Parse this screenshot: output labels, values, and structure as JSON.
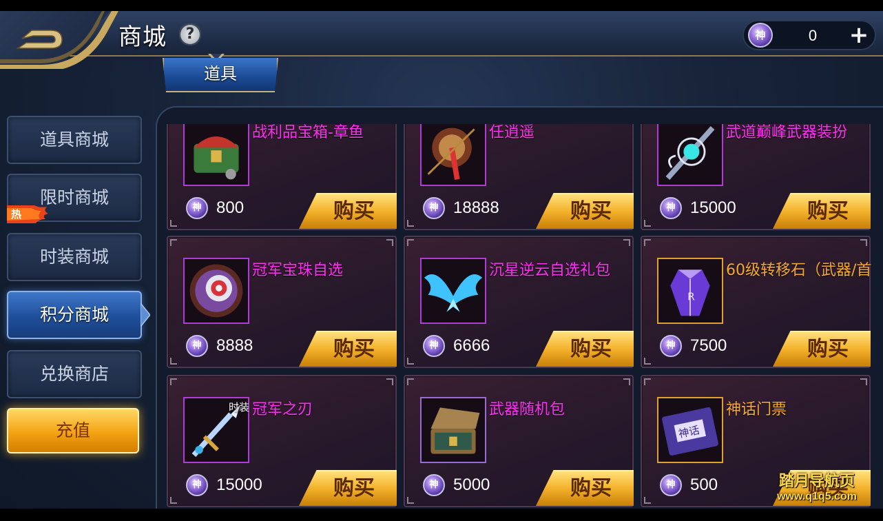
{
  "header": {
    "title": "商城",
    "help_symbol": "?",
    "currency": {
      "icon": "jade-coin-icon",
      "amount": "0",
      "add_symbol": "+"
    }
  },
  "tab": {
    "label": "道具"
  },
  "sidebar": {
    "items": [
      {
        "label": "道具商城",
        "active": false
      },
      {
        "label": "限时商城",
        "active": false,
        "badge": "热"
      },
      {
        "label": "时装商城",
        "active": false
      },
      {
        "label": "积分商城",
        "active": true
      },
      {
        "label": "兑换商店",
        "active": false
      }
    ],
    "recharge_label": "充值"
  },
  "coin_glyph": "神",
  "buy_label": "购买",
  "products": [
    {
      "name": "战利品宝箱-章鱼",
      "price": "800",
      "icon": "treasure-chest-icon",
      "frame": "magenta",
      "name_color": "magenta"
    },
    {
      "name": "任逍遥",
      "price": "18888",
      "icon": "umbrella-weapon-icon",
      "frame": "magenta",
      "name_color": "magenta"
    },
    {
      "name": "武道巅峰武器装扮",
      "price": "15000",
      "icon": "ornate-key-weapon-icon",
      "frame": "magenta",
      "name_color": "magenta"
    },
    {
      "name": "冠军宝珠自选",
      "price": "8888",
      "icon": "orb-icon",
      "frame": "magenta",
      "name_color": "magenta"
    },
    {
      "name": "沉星逆云自选礼包",
      "price": "6666",
      "icon": "blue-wings-icon",
      "frame": "magenta",
      "name_color": "magenta"
    },
    {
      "name": "60级转移石（武器/首",
      "price": "7500",
      "icon": "purple-crystal-icon",
      "frame": "gold",
      "name_color": "gold"
    },
    {
      "name": "冠军之刃",
      "price": "15000",
      "icon": "sword-icon",
      "frame": "magenta",
      "name_color": "magenta",
      "tag": "时装"
    },
    {
      "name": "武器随机包",
      "price": "5000",
      "icon": "open-chest-icon",
      "frame": "violet",
      "name_color": "magenta"
    },
    {
      "name": "神话门票",
      "price": "500",
      "icon": "ticket-icon",
      "frame": "gold",
      "name_color": "gold"
    }
  ],
  "watermark": {
    "line1": "踏月导航页",
    "line2": "www.q1q5.com"
  },
  "colors": {
    "accent_gold": "#f3b12b",
    "name_magenta": "#ff2ff3",
    "name_gold": "#f7a92c",
    "active_blue": "#1f4f9a"
  }
}
